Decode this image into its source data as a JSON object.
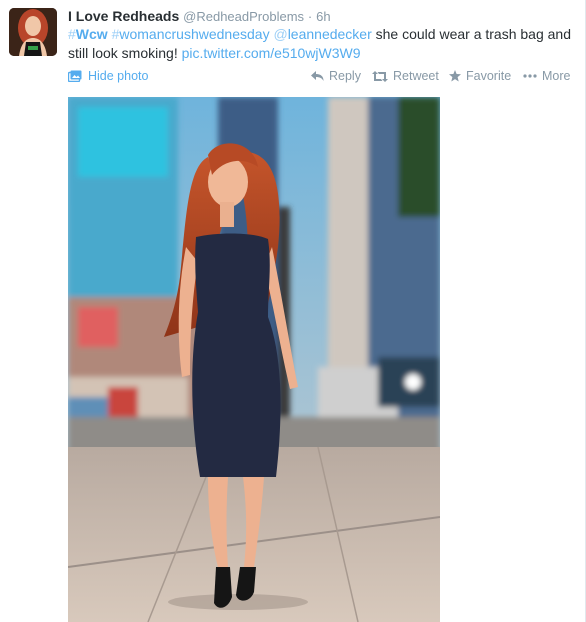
{
  "tweet": {
    "fullname": "I Love Redheads",
    "screenname": "@RedheadProblems",
    "separator": "·",
    "time": "6h",
    "text": {
      "hashtag1_hash": "#",
      "hashtag1_tag": "Wcw",
      "hashtag2_hash": "#",
      "hashtag2_tag": "womancrushwednesday",
      "mention_at": "@",
      "mention_user": "leannedecker",
      "body": " she could wear a trash bag and still look smoking! ",
      "pic_link": "pic.twitter.com/e510wjW3W9"
    }
  },
  "actions": {
    "hide_photo": "Hide photo",
    "reply": "Reply",
    "retweet": "Retweet",
    "favorite": "Favorite",
    "more": "More"
  },
  "colors": {
    "link": "#55acee",
    "muted": "#8899a6",
    "text": "#292f33"
  },
  "icons": {
    "hide_photo": "photo-icon",
    "reply": "reply-icon",
    "retweet": "retweet-icon",
    "favorite": "star-icon",
    "more": "more-dots-icon"
  }
}
